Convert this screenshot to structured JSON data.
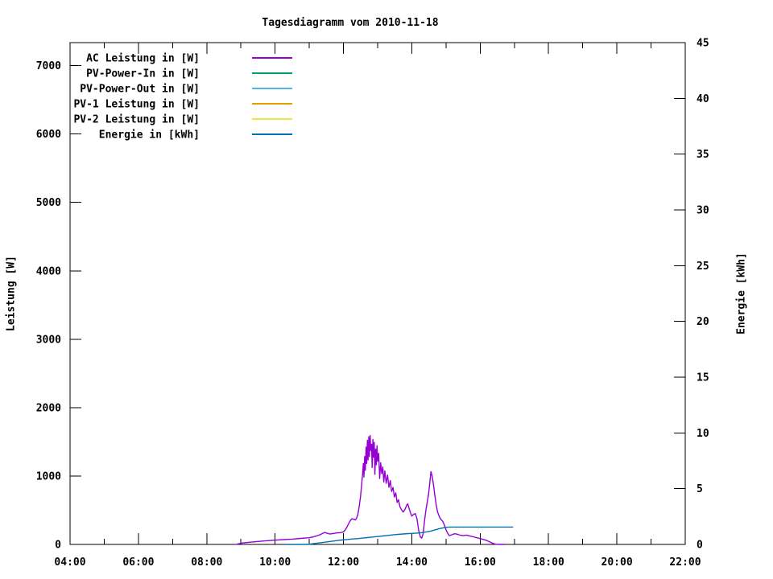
{
  "title": "Tagesdiagramm vom 2010-11-18",
  "chart_data": {
    "type": "line",
    "title": "Tagesdiagramm vom 2010-11-18",
    "grid": false,
    "legend_position": "top-left",
    "background": "#ffffff",
    "axis_color": "#000000",
    "x_axis": {
      "label": "",
      "range_hours": [
        4,
        22
      ],
      "major_tick_hours": [
        4,
        6,
        8,
        10,
        12,
        14,
        16,
        18,
        20,
        22
      ],
      "major_tick_labels": [
        "04:00",
        "06:00",
        "08:00",
        "10:00",
        "12:00",
        "14:00",
        "16:00",
        "18:00",
        "20:00",
        "22:00"
      ],
      "minor_tick_hours": [
        5,
        7,
        9,
        11,
        13,
        15,
        17,
        19,
        21
      ]
    },
    "y_left": {
      "label": "Leistung [W]",
      "ticks": [
        0,
        1000,
        2000,
        3000,
        4000,
        5000,
        6000,
        7000
      ],
      "range": [
        0,
        7336
      ]
    },
    "y_right": {
      "label": "Energie [kWh]",
      "ticks": [
        0,
        5,
        10,
        15,
        20,
        25,
        30,
        35,
        40,
        45
      ],
      "range": [
        0,
        45
      ]
    },
    "legend": [
      {
        "label": "AC Leistung in [W]",
        "color": "#9400D3"
      },
      {
        "label": "PV-Power-In in [W]",
        "color": "#009E73"
      },
      {
        "label": "PV-Power-Out in [W]",
        "color": "#56B4E9"
      },
      {
        "label": "PV-1 Leistung in [W]",
        "color": "#E69F00"
      },
      {
        "label": "PV-2 Leistung in [W]",
        "color": "#F0E442"
      },
      {
        "label": "Energie in [kWh]",
        "color": "#0072B2"
      }
    ],
    "series": [
      {
        "name": "AC Leistung in [W]",
        "color": "#9400D3",
        "axis": "left",
        "points": [
          [
            8.85,
            0
          ],
          [
            9.0,
            18
          ],
          [
            9.25,
            32
          ],
          [
            9.5,
            44
          ],
          [
            9.75,
            54
          ],
          [
            10.0,
            62
          ],
          [
            10.25,
            70
          ],
          [
            10.5,
            78
          ],
          [
            10.75,
            88
          ],
          [
            11.0,
            98
          ],
          [
            11.1,
            108
          ],
          [
            11.2,
            122
          ],
          [
            11.3,
            140
          ],
          [
            11.4,
            163
          ],
          [
            11.45,
            175
          ],
          [
            11.5,
            167
          ],
          [
            11.6,
            152
          ],
          [
            11.7,
            160
          ],
          [
            11.8,
            168
          ],
          [
            11.9,
            172
          ],
          [
            12.0,
            182
          ],
          [
            12.05,
            212
          ],
          [
            12.1,
            252
          ],
          [
            12.15,
            302
          ],
          [
            12.2,
            348
          ],
          [
            12.25,
            376
          ],
          [
            12.3,
            368
          ],
          [
            12.35,
            360
          ],
          [
            12.38,
            378
          ],
          [
            12.42,
            436
          ],
          [
            12.46,
            556
          ],
          [
            12.5,
            704
          ],
          [
            12.53,
            872
          ],
          [
            12.56,
            1024
          ],
          [
            12.58,
            1184
          ],
          [
            12.6,
            984
          ],
          [
            12.62,
            1284
          ],
          [
            12.64,
            1084
          ],
          [
            12.66,
            1424
          ],
          [
            12.68,
            1184
          ],
          [
            12.7,
            1524
          ],
          [
            12.72,
            1234
          ],
          [
            12.74,
            1574
          ],
          [
            12.76,
            1284
          ],
          [
            12.78,
            1592
          ],
          [
            12.8,
            1374
          ],
          [
            12.82,
            1464
          ],
          [
            12.84,
            1124
          ],
          [
            12.86,
            1534
          ],
          [
            12.88,
            1274
          ],
          [
            12.9,
            1492
          ],
          [
            12.92,
            1024
          ],
          [
            12.94,
            1394
          ],
          [
            12.96,
            1164
          ],
          [
            12.98,
            1442
          ],
          [
            13.0,
            1214
          ],
          [
            13.03,
            1332
          ],
          [
            13.06,
            964
          ],
          [
            13.09,
            1194
          ],
          [
            13.12,
            1034
          ],
          [
            13.15,
            1132
          ],
          [
            13.18,
            914
          ],
          [
            13.21,
            1074
          ],
          [
            13.25,
            894
          ],
          [
            13.29,
            1014
          ],
          [
            13.33,
            834
          ],
          [
            13.37,
            934
          ],
          [
            13.41,
            774
          ],
          [
            13.45,
            834
          ],
          [
            13.49,
            694
          ],
          [
            13.53,
            754
          ],
          [
            13.57,
            614
          ],
          [
            13.61,
            654
          ],
          [
            13.65,
            554
          ],
          [
            13.7,
            504
          ],
          [
            13.75,
            474
          ],
          [
            13.8,
            514
          ],
          [
            13.85,
            574
          ],
          [
            13.88,
            594
          ],
          [
            13.92,
            528
          ],
          [
            13.96,
            464
          ],
          [
            14.0,
            414
          ],
          [
            14.05,
            438
          ],
          [
            14.1,
            452
          ],
          [
            14.15,
            378
          ],
          [
            14.2,
            208
          ],
          [
            14.25,
            108
          ],
          [
            14.29,
            92
          ],
          [
            14.33,
            158
          ],
          [
            14.37,
            332
          ],
          [
            14.41,
            492
          ],
          [
            14.45,
            614
          ],
          [
            14.49,
            734
          ],
          [
            14.53,
            914
          ],
          [
            14.56,
            1065
          ],
          [
            14.59,
            1008
          ],
          [
            14.63,
            888
          ],
          [
            14.67,
            728
          ],
          [
            14.71,
            588
          ],
          [
            14.75,
            478
          ],
          [
            14.79,
            424
          ],
          [
            14.82,
            392
          ],
          [
            14.86,
            362
          ],
          [
            14.9,
            342
          ],
          [
            14.94,
            302
          ],
          [
            14.98,
            242
          ],
          [
            15.02,
            192
          ],
          [
            15.06,
            156
          ],
          [
            15.1,
            128
          ],
          [
            15.18,
            142
          ],
          [
            15.25,
            156
          ],
          [
            15.32,
            150
          ],
          [
            15.4,
            136
          ],
          [
            15.5,
            128
          ],
          [
            15.6,
            136
          ],
          [
            15.7,
            122
          ],
          [
            15.8,
            112
          ],
          [
            15.9,
            98
          ],
          [
            16.0,
            86
          ],
          [
            16.1,
            72
          ],
          [
            16.2,
            56
          ],
          [
            16.3,
            32
          ],
          [
            16.38,
            14
          ],
          [
            16.45,
            4
          ],
          [
            16.55,
            0
          ],
          [
            16.72,
            0
          ]
        ]
      },
      {
        "name": "PV-Power-In in [W]",
        "color": "#009E73",
        "axis": "left",
        "points": []
      },
      {
        "name": "PV-Power-Out in [W]",
        "color": "#56B4E9",
        "axis": "left",
        "points": []
      },
      {
        "name": "PV-1 Leistung in [W]",
        "color": "#E69F00",
        "axis": "left",
        "points": []
      },
      {
        "name": "PV-2 Leistung in [W]",
        "color": "#F0E442",
        "axis": "left",
        "points": []
      },
      {
        "name": "Energie in [kWh]",
        "color": "#0072B2",
        "axis": "right",
        "points": [
          [
            10.33,
            0
          ],
          [
            10.95,
            0
          ],
          [
            11.05,
            0.04
          ],
          [
            11.2,
            0.1
          ],
          [
            11.35,
            0.16
          ],
          [
            11.5,
            0.22
          ],
          [
            11.65,
            0.28
          ],
          [
            11.8,
            0.34
          ],
          [
            11.95,
            0.4
          ],
          [
            12.1,
            0.44
          ],
          [
            12.25,
            0.48
          ],
          [
            12.4,
            0.52
          ],
          [
            12.55,
            0.56
          ],
          [
            12.7,
            0.61
          ],
          [
            12.85,
            0.66
          ],
          [
            13.0,
            0.71
          ],
          [
            13.15,
            0.76
          ],
          [
            13.3,
            0.81
          ],
          [
            13.45,
            0.86
          ],
          [
            13.6,
            0.9
          ],
          [
            13.75,
            0.94
          ],
          [
            13.9,
            0.97
          ],
          [
            14.0,
            0.99
          ],
          [
            14.15,
            1.02
          ],
          [
            14.3,
            1.06
          ],
          [
            14.45,
            1.13
          ],
          [
            14.55,
            1.2
          ],
          [
            14.65,
            1.28
          ],
          [
            14.75,
            1.36
          ],
          [
            14.85,
            1.44
          ],
          [
            14.95,
            1.5
          ],
          [
            15.05,
            1.54
          ],
          [
            15.15,
            1.56
          ],
          [
            16.95,
            1.56
          ]
        ]
      }
    ]
  }
}
